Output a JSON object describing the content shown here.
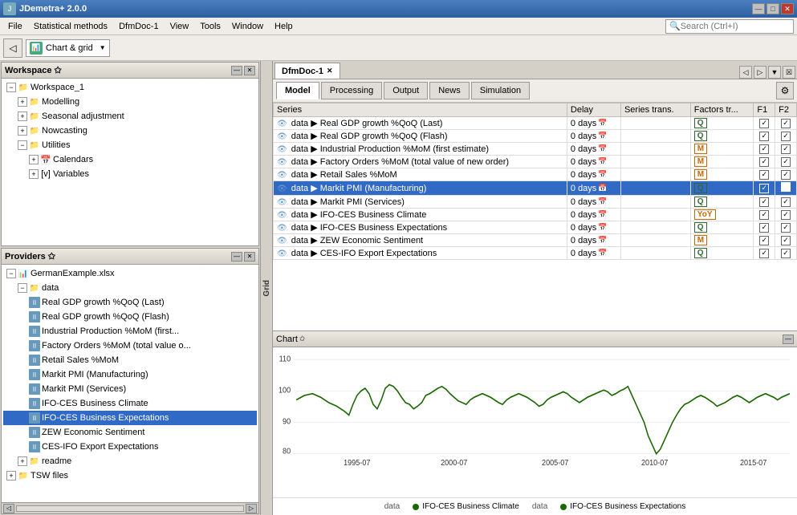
{
  "titleBar": {
    "title": "JDemetra+ 2.0.0",
    "controls": [
      "—",
      "□",
      "✕"
    ]
  },
  "menuBar": {
    "items": [
      "File",
      "Statistical methods",
      "DfmDoc-1",
      "View",
      "Tools",
      "Window",
      "Help"
    ],
    "searchPlaceholder": "Search (Ctrl+I)"
  },
  "toolbar": {
    "dropdownLabel": "Chart & grid"
  },
  "workspace": {
    "title": "Workspace ☆",
    "root": "Workspace_1",
    "items": [
      {
        "label": "Modelling",
        "indent": 2,
        "type": "folder",
        "expanded": true
      },
      {
        "label": "Seasonal adjustment",
        "indent": 2,
        "type": "folder"
      },
      {
        "label": "Nowcasting",
        "indent": 2,
        "type": "folder"
      },
      {
        "label": "Utilities",
        "indent": 2,
        "type": "folder",
        "expanded": true
      },
      {
        "label": "Calendars",
        "indent": 3,
        "type": "calendar"
      },
      {
        "label": "Variables",
        "indent": 3,
        "type": "variable"
      }
    ]
  },
  "providers": {
    "title": "Providers ☆",
    "items": [
      {
        "label": "GermanExample.xlsx",
        "indent": 1,
        "type": "xlsx"
      },
      {
        "label": "data",
        "indent": 2,
        "type": "folder"
      },
      {
        "label": "Real GDP growth %QoQ (Last)",
        "indent": 3,
        "type": "data"
      },
      {
        "label": "Real GDP growth %QoQ (Flash)",
        "indent": 3,
        "type": "data"
      },
      {
        "label": "Industrial Production %MoM (first es...",
        "indent": 3,
        "type": "data"
      },
      {
        "label": "Factory Orders %MoM (total value o...",
        "indent": 3,
        "type": "data"
      },
      {
        "label": "Retail Sales %MoM",
        "indent": 3,
        "type": "data"
      },
      {
        "label": "Markit PMI (Manufacturing)",
        "indent": 3,
        "type": "data"
      },
      {
        "label": "Markit PMI (Services)",
        "indent": 3,
        "type": "data"
      },
      {
        "label": "IFO-CES Business Climate",
        "indent": 3,
        "type": "data"
      },
      {
        "label": "IFO-CES Business Expectations",
        "indent": 3,
        "type": "data",
        "selected": true
      },
      {
        "label": "ZEW Economic Sentiment",
        "indent": 3,
        "type": "data"
      },
      {
        "label": "CES-IFO Export Expectations",
        "indent": 3,
        "type": "data"
      },
      {
        "label": "readme",
        "indent": 2,
        "type": "folder"
      },
      {
        "label": "TSW files",
        "indent": 1,
        "type": "folder"
      }
    ]
  },
  "mainTab": {
    "label": "DfmDoc-1",
    "closeBtn": "✕"
  },
  "subTabs": {
    "tabs": [
      "Model",
      "Processing",
      "Output",
      "News",
      "Simulation"
    ],
    "active": "Model"
  },
  "tableHeaders": [
    "Series",
    "Delay",
    "Series trans.",
    "Factors tr...",
    "F1",
    "F2"
  ],
  "tableRows": [
    {
      "series": "data ▶ Real GDP growth %QoQ (Last)",
      "delay": "0 days",
      "hasCal": true,
      "seriesTrans": "",
      "factorsTrans": "Q",
      "factorBadge": "q",
      "f1": true,
      "f2": true,
      "selected": false
    },
    {
      "series": "data ▶ Real GDP growth %QoQ (Flash)",
      "delay": "0 days",
      "hasCal": true,
      "seriesTrans": "",
      "factorsTrans": "Q",
      "factorBadge": "q",
      "f1": true,
      "f2": true,
      "selected": false
    },
    {
      "series": "data ▶ Industrial Production %MoM (first estimate)",
      "delay": "0 days",
      "hasCal": true,
      "seriesTrans": "",
      "factorsTrans": "M",
      "factorBadge": "m",
      "f1": true,
      "f2": true,
      "selected": false
    },
    {
      "series": "data ▶ Factory Orders %MoM (total value of new order)",
      "delay": "0 days",
      "hasCal": true,
      "seriesTrans": "",
      "factorsTrans": "M",
      "factorBadge": "m",
      "f1": true,
      "f2": true,
      "selected": false
    },
    {
      "series": "data ▶ Retail Sales %MoM",
      "delay": "0 days",
      "hasCal": true,
      "seriesTrans": "",
      "factorsTrans": "M",
      "factorBadge": "m",
      "f1": true,
      "f2": true,
      "selected": false
    },
    {
      "series": "data ▶ Markit PMI (Manufacturing)",
      "delay": "0 days",
      "hasCal": true,
      "seriesTrans": "",
      "factorsTrans": "Q",
      "factorBadge": "q",
      "f1": true,
      "f2": false,
      "selected": true
    },
    {
      "series": "data ▶ Markit PMI (Services)",
      "delay": "0 days",
      "hasCal": true,
      "seriesTrans": "",
      "factorsTrans": "Q",
      "factorBadge": "q",
      "f1": true,
      "f2": true,
      "selected": false
    },
    {
      "series": "data ▶ IFO-CES Business Climate",
      "delay": "0 days",
      "hasCal": true,
      "seriesTrans": "",
      "factorsTrans": "YoY",
      "factorBadge": "yoy",
      "f1": true,
      "f2": true,
      "selected": false
    },
    {
      "series": "data ▶ IFO-CES Business Expectations",
      "delay": "0 days",
      "hasCal": true,
      "seriesTrans": "",
      "factorsTrans": "Q",
      "factorBadge": "q",
      "f1": true,
      "f2": true,
      "selected": false
    },
    {
      "series": "data ▶ ZEW Economic Sentiment",
      "delay": "0 days",
      "hasCal": true,
      "seriesTrans": "",
      "factorsTrans": "M",
      "factorBadge": "m",
      "f1": true,
      "f2": true,
      "selected": false
    },
    {
      "series": "data ▶ CES-IFO  Export Expectations",
      "delay": "0 days",
      "hasCal": true,
      "seriesTrans": "",
      "factorsTrans": "Q",
      "factorBadge": "q",
      "f1": true,
      "f2": true,
      "selected": false
    }
  ],
  "chart": {
    "title": "Chart",
    "closeBtn": "☒",
    "xLabels": [
      "1995-07",
      "2000-07",
      "2005-07",
      "2010-07",
      "2015-07"
    ],
    "yLabels": [
      "80",
      "90",
      "100",
      "110"
    ],
    "legend": [
      {
        "color": "#1a6600",
        "label1": "data",
        "label2": "IFO-CES Business Climate"
      },
      {
        "color": "#1a6600",
        "label1": "data",
        "label2": "IFO-CES Business Expectations"
      }
    ]
  }
}
